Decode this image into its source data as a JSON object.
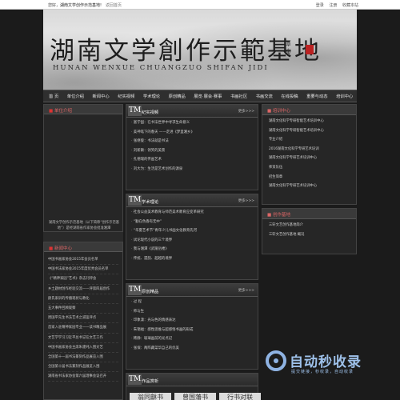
{
  "topbar": {
    "welcome": "您好，",
    "site": "湖南文学创作示范基地!",
    "back": "返回首页",
    "login": "登录",
    "register": "注册",
    "favorite": "收藏本站"
  },
  "banner": {
    "title_cn": "湖南文学創作示範基地",
    "title_en": "HUNAN WENXUE CHUANGZUO SHIFAN JIDI",
    "signature": "谭 谈"
  },
  "nav": {
    "items": [
      "首 页",
      "单位介绍",
      "新闻中心",
      "纪实视频",
      "学术理论",
      "原创精品",
      "展览·展会·赛事",
      "书画社区",
      "书画交流",
      "在线投稿",
      "重要与动态",
      "培训中心"
    ]
  },
  "intro": {
    "heading": "单位介绍",
    "text": "湖南文学创作示范基地（以下简称“创作示范基地”）是经湖南省作家协会批准湘潭"
  },
  "news": {
    "heading": "新闻中心",
    "items": [
      "中国书画家协会2015年会员名单",
      "中国书法家协会2015年度优秀会员名单",
      "《“精神家园”艺术》杂志刊评会",
      "乡土题材创作经验交流——评第四届创作",
      "颜氏家训的传播现状与教化",
      "五大事件回顾观察",
      "周国平先生书法艺术之道鉴评点",
      "首家入驻精神家园专业一一读书精品展",
      "文艺学学习习近平总书记在文艺工作",
      "中国书画家协会主席朱建纯入围文艺",
      "全国第十一届书法篆刻作品展览入围",
      "全国第十届书法篆刻作品展览入围",
      "湖南省书法家协会第六届理事会议召开"
    ]
  },
  "video": {
    "heading": "纪实视频",
    "more": "更多>>>",
    "items": [
      "富学国：在书法世界中寻求生命意义",
      "美神笔下的春天 ——走进《梦里湘乡》",
      "张继俊：书法就是书法",
      "刘新颖：领笑的美景",
      "孔德瑞的传画艺术",
      "刘大为：生活是艺术创作的源泉"
    ]
  },
  "theory": {
    "heading": "学术理论",
    "more": "更多>>>",
    "items": [
      "社会公益美术教育与师范美术教育应变革研究",
      "“勤在色香有无中”",
      "“华夏艺术节”青年少儿书画文化教育先河",
      "试论现代小说的三个境界",
      "我与湘潭《武陵岳楼》",
      "传统、遗韵、超越的境界"
    ]
  },
  "original": {
    "heading": "原创精品",
    "more": "更多>>>",
    "items": [
      "过 程",
      "师与生",
      "印象潇：光与色的情感表达",
      "朱锡福：感性思维与超感悟书画的形成",
      "韩静：玻璃画前的光点记",
      "张保：两阵藏菜华自己的优美"
    ]
  },
  "gallery": {
    "heading": "作品赏析",
    "thumbs": [
      "翁同龢书",
      "曾国藩书",
      "行书对联"
    ]
  },
  "training": {
    "heading": "培训中心",
    "items": [
      "湖南文化科学专研智能艺术培训中心",
      "湖南文化科学专研智能艺术培训中心",
      "专业介绍",
      "2016湖南文化科学专研艺术培训",
      "湖南文化科学专研艺术培训中心",
      "师资队伍",
      "招生简章",
      "湖南文化科学专研艺术培训中心"
    ]
  },
  "base": {
    "heading": "创作基地",
    "items": [
      "三轩文艺创作基地简介",
      "三轩文艺创作基地 概况"
    ]
  },
  "watermark": {
    "title": "自动秒收录",
    "sub": "提交链接，秒收录，自动收录"
  }
}
